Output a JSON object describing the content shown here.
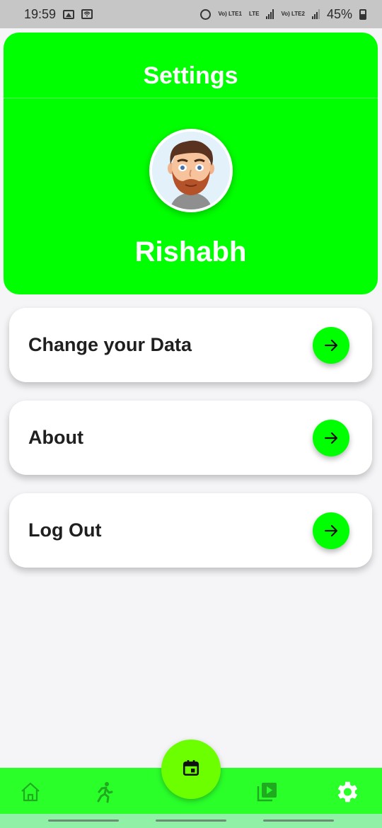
{
  "status_bar": {
    "time": "19:59",
    "battery": "45%",
    "sim1_label": "Vo) LTE1",
    "lte_label": "LTE",
    "sim2_label": "Vo) LTE2"
  },
  "header": {
    "title": "Settings",
    "user_name": "Rishabh",
    "background_color": "#00ff00"
  },
  "menu": {
    "items": [
      {
        "label": "Change your Data",
        "icon": "arrow-right-icon"
      },
      {
        "label": "About",
        "icon": "arrow-right-icon"
      },
      {
        "label": "Log Out",
        "icon": "arrow-right-icon"
      }
    ]
  },
  "bottom_nav": {
    "items": [
      {
        "icon": "home-icon"
      },
      {
        "icon": "running-icon"
      },
      {
        "icon": "calendar-icon"
      },
      {
        "icon": "video-library-icon"
      },
      {
        "icon": "gear-icon",
        "active": true
      }
    ],
    "accent_color": "#2aff2a"
  }
}
